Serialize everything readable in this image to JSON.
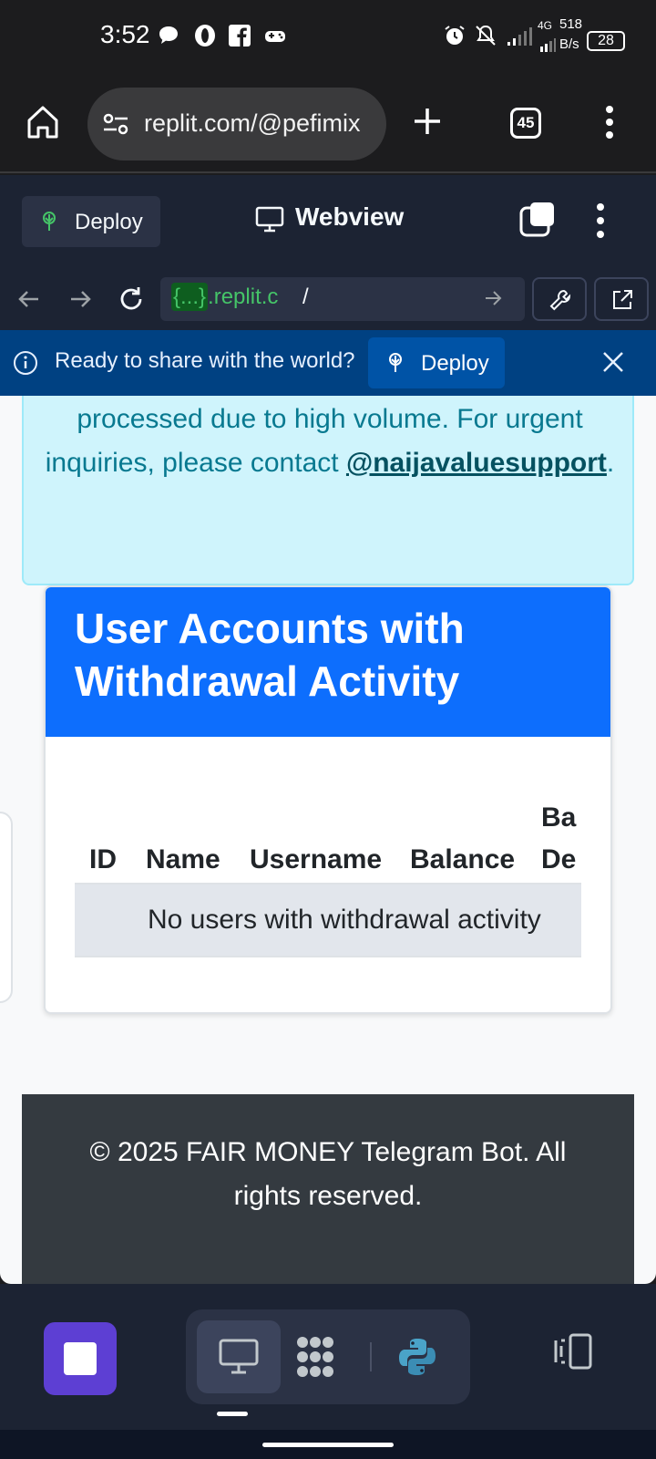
{
  "status_bar": {
    "time": "3:52",
    "network": "4G",
    "speed_value": "518",
    "speed_unit": "B/s",
    "battery": "28"
  },
  "browser": {
    "url": "replit.com/@pefimix",
    "tab_count": "45"
  },
  "replit": {
    "deploy_label": "Deploy",
    "webview_label": "Webview",
    "address_host_badge": "{...}",
    "address_host": ".replit.c",
    "address_path": "/"
  },
  "banner": {
    "text": "Ready to share with the world?",
    "deploy_label": "Deploy"
  },
  "notice": {
    "text_before": "processed due to high volume. For urgent inquiries, please contact ",
    "link": "@naijavaluesupport",
    "text_after": "."
  },
  "card": {
    "title": "User Accounts with Withdrawal Activity",
    "columns": [
      "ID",
      "Name",
      "Username",
      "Balance",
      "Ba",
      "De"
    ],
    "empty_message": "No users with withdrawal activity"
  },
  "footer": {
    "text": "© 2025 FAIR MONEY Telegram Bot. All rights reserved."
  },
  "colors": {
    "card_header": "#0d6efd",
    "notice_bg": "#cff4fc",
    "notice_text": "#087990",
    "footer_bg": "#343a40",
    "banner_bg": "#004182",
    "replit_bg": "#1c2333",
    "stop_button": "#5d3fd3"
  },
  "icons": [
    "home-icon",
    "site-settings-icon",
    "new-tab-icon",
    "tab-switcher-icon",
    "overflow-menu-icon",
    "deploy-icon",
    "monitor-icon",
    "new-window-icon",
    "kebab-menu-icon",
    "back-arrow-icon",
    "forward-arrow-icon",
    "reload-icon",
    "go-arrow-icon",
    "devtools-wrench-icon",
    "open-external-icon",
    "info-icon",
    "close-icon",
    "stop-icon",
    "webview-monitor-icon",
    "shell-icon",
    "python-icon",
    "split-panel-icon"
  ]
}
